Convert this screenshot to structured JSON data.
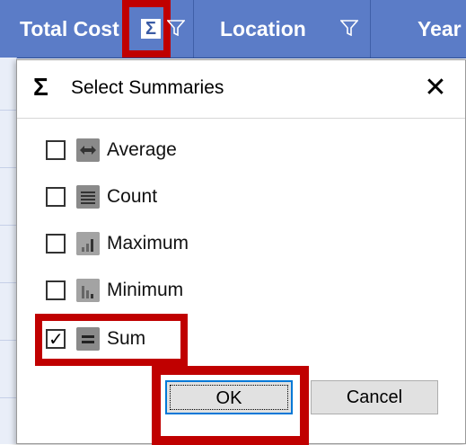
{
  "grid": {
    "columns": [
      {
        "label": "Total Cost"
      },
      {
        "label": "Location"
      },
      {
        "label": "Year"
      }
    ],
    "sigma_glyph": "Σ",
    "header_color": "#5b7cc7",
    "highlight_color": "#c00000"
  },
  "dialog": {
    "title_glyph": "Σ",
    "title": "Select Summaries",
    "close_glyph": "✕",
    "options": [
      {
        "label": "Average",
        "checked": false,
        "icon": "average-icon"
      },
      {
        "label": "Count",
        "checked": false,
        "icon": "count-icon"
      },
      {
        "label": "Maximum",
        "checked": false,
        "icon": "maximum-icon"
      },
      {
        "label": "Minimum",
        "checked": false,
        "icon": "minimum-icon"
      },
      {
        "label": "Sum",
        "checked": true,
        "icon": "sum-icon"
      }
    ],
    "ok_label": "OK",
    "cancel_label": "Cancel"
  }
}
